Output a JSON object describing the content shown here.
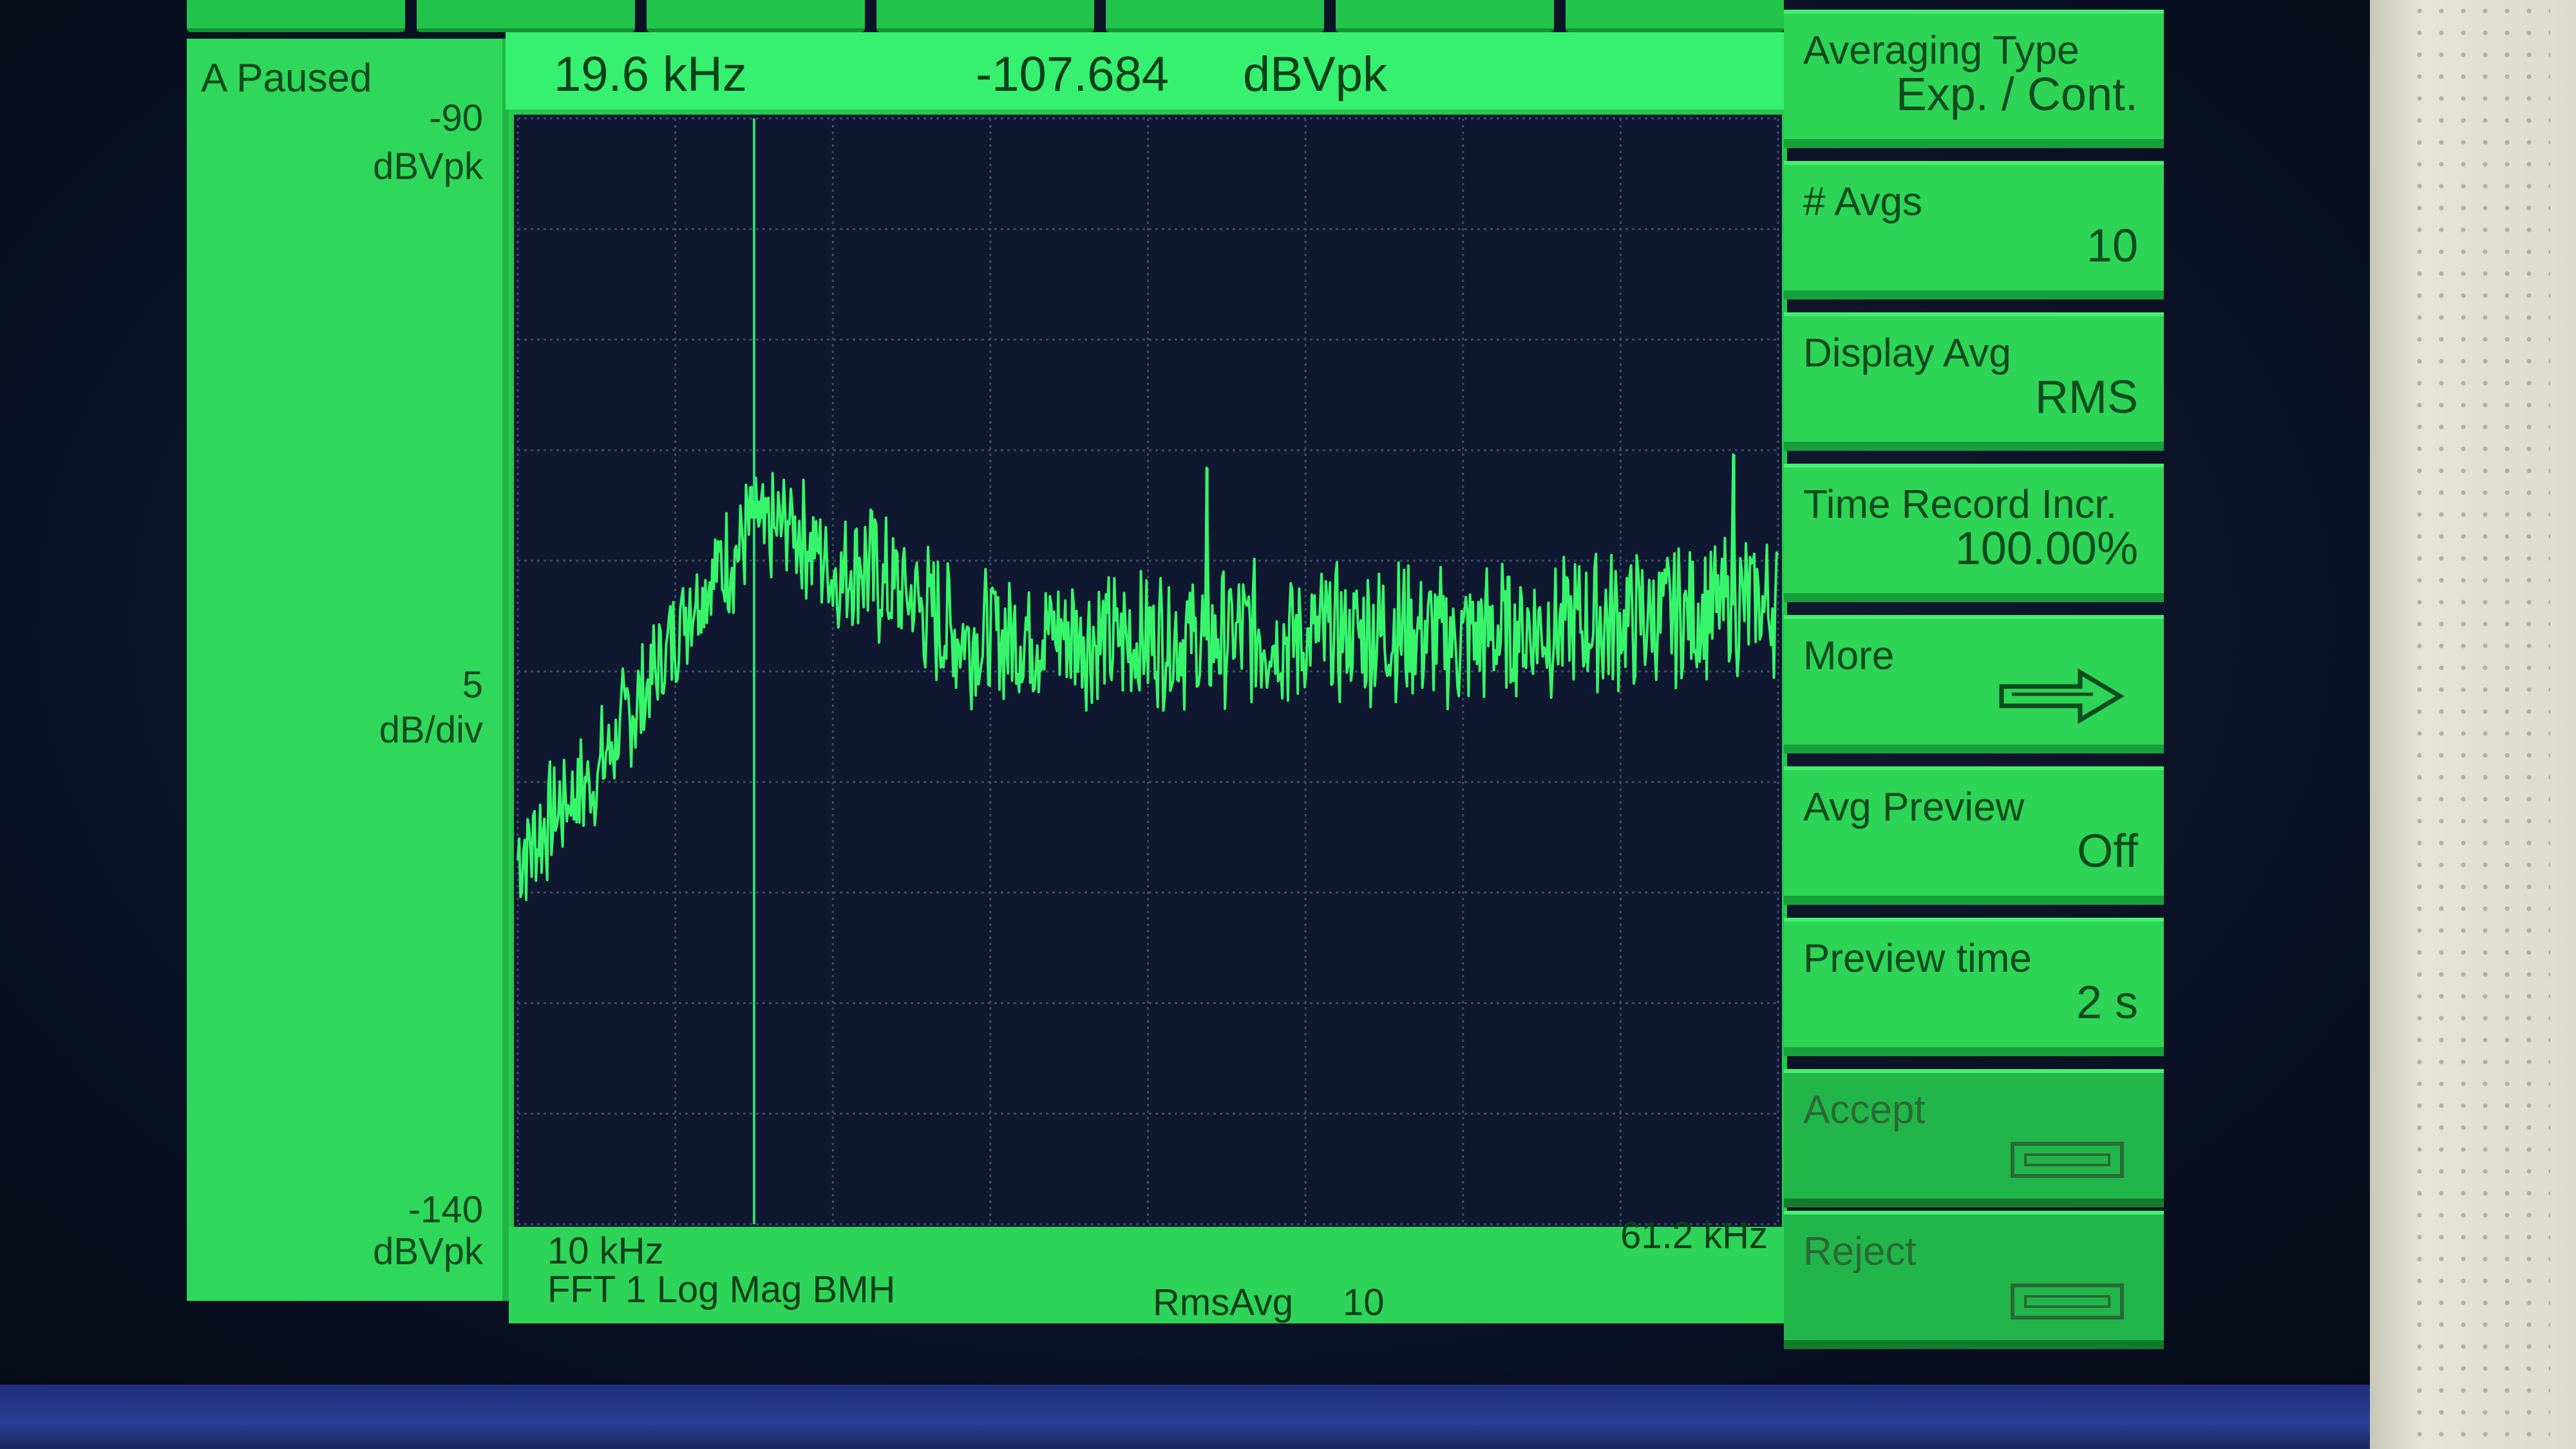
{
  "top_tabs": [
    "",
    "",
    "",
    "",
    "",
    "",
    ""
  ],
  "left_panel": {
    "status": "A Paused",
    "top_value": "-90",
    "top_unit": "dBVpk",
    "scale_value": "5",
    "scale_unit": "dB/div",
    "bottom_value": "-140",
    "bottom_unit": "dBVpk"
  },
  "marker": {
    "frequency": "19.6 kHz",
    "value": "-107.684",
    "unit": "dBVpk"
  },
  "bottom_bar": {
    "start_freq": "10 kHz",
    "stop_freq": "61.2 kHz",
    "trace_info": "FFT 1 Log Mag BMH",
    "avg_mode": "RmsAvg",
    "avg_count": "10"
  },
  "softkeys": [
    {
      "label": "Averaging Type",
      "value": "Exp. / Cont.",
      "enabled": true
    },
    {
      "label": "# Avgs",
      "value": "10",
      "enabled": true
    },
    {
      "label": "Display Avg",
      "value": "RMS",
      "enabled": true
    },
    {
      "label": "Time Record Incr.",
      "value": "100.00%",
      "enabled": true
    },
    {
      "label": "More",
      "value": "",
      "icon": "arrow-right-icon",
      "enabled": true
    },
    {
      "label": "Avg Preview",
      "value": "Off",
      "enabled": true
    },
    {
      "label": "Preview time",
      "value": "2 s",
      "enabled": true
    },
    {
      "label": "Accept",
      "value": "",
      "icon": "button-rect-icon",
      "enabled": false
    },
    {
      "label": "Reject",
      "value": "",
      "icon": "button-rect-icon",
      "enabled": false
    }
  ],
  "colors": {
    "trace": "#36f56a",
    "panel": "#2fd85a",
    "graph_bg": "#0f1830",
    "grid": "#3a4a66"
  },
  "chart_data": {
    "type": "line",
    "xlim": [
      10,
      61.2
    ],
    "ylim": [
      -140,
      -90
    ],
    "x_unit": "kHz",
    "y_unit": "dBVpk",
    "grid": true,
    "x_divisions": 8,
    "y_divisions": 10,
    "marker": {
      "x": 19.6,
      "y": -107.684
    },
    "series": [
      {
        "x": [
          10,
          11,
          12,
          13,
          14,
          15,
          16,
          17,
          18,
          19,
          19.6,
          20,
          21,
          22,
          23,
          24,
          25,
          26,
          27,
          28,
          30,
          32,
          34,
          36,
          38,
          40,
          42,
          44,
          46,
          48,
          50,
          52,
          54,
          56,
          58,
          60,
          61.2
        ],
        "y": [
          -123.5,
          -122.2,
          -120.7,
          -120.0,
          -118.0,
          -116.2,
          -114.2,
          -111.8,
          -110.6,
          -109.5,
          -107.7,
          -109.0,
          -108.2,
          -109.4,
          -110.8,
          -110.0,
          -111.2,
          -111.6,
          -112.7,
          -113.4,
          -113.4,
          -113.2,
          -113.7,
          -113.4,
          -113.6,
          -113.2,
          -113.5,
          -113.3,
          -113.1,
          -113.6,
          -113.2,
          -113.0,
          -112.8,
          -112.6,
          -112.3,
          -111.9,
          -112.0
        ]
      }
    ],
    "spurs": [
      {
        "x": 38,
        "y": -105.8
      },
      {
        "x": 59.4,
        "y": -105.2
      }
    ]
  }
}
